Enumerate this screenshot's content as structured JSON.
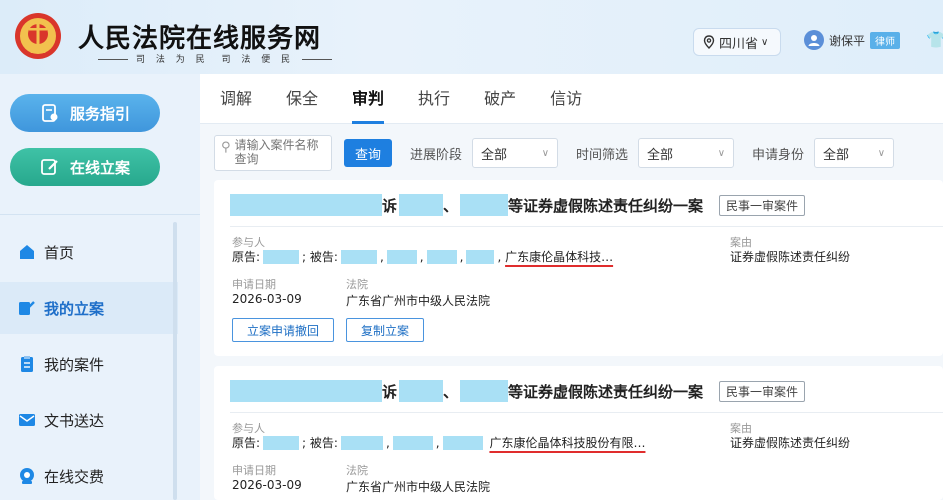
{
  "header": {
    "site_title": "人民法院在线服务网",
    "slogan_left": "司 法 为 民",
    "slogan_right": "司 法 便 民",
    "region": "四川省",
    "user_name": "谢保平",
    "user_badge": "律师"
  },
  "sidebar": {
    "guide_button": "服务指引",
    "file_button": "在线立案",
    "items": [
      {
        "label": "首页",
        "icon": "home-icon",
        "color": "#1e88e5"
      },
      {
        "label": "我的立案",
        "icon": "edit-icon",
        "color": "#1e88e5",
        "active": true
      },
      {
        "label": "我的案件",
        "icon": "clipboard-icon",
        "color": "#1e88e5"
      },
      {
        "label": "文书送达",
        "icon": "mail-icon",
        "color": "#1e88e5"
      },
      {
        "label": "在线交费",
        "icon": "payment-icon",
        "color": "#1e88e5"
      }
    ]
  },
  "tabs": [
    "调解",
    "保全",
    "审判",
    "执行",
    "破产",
    "信访"
  ],
  "active_tab": "审判",
  "filters": {
    "search_placeholder": "请输入案件名称查询",
    "query_button": "查询",
    "stage_label": "进展阶段",
    "stage_value": "全部",
    "time_label": "时间筛选",
    "time_value": "全部",
    "role_label": "申请身份",
    "role_value": "全部"
  },
  "cases": [
    {
      "title_part1": "诉",
      "title_sep": "、",
      "title_part2": "等证券虚假陈述责任纠纷一案",
      "case_type": "民事一审案件",
      "participants_label": "参与人",
      "plaintiff_label": "原告:",
      "defendant_label": "被告:",
      "defendant_visible": "广东康伦晶体科技…",
      "cause_label": "案由",
      "cause": "证券虚假陈述责任纠纷",
      "date_label": "申请日期",
      "date": "2026-03-09",
      "court_label": "法院",
      "court": "广东省广州市中级人民法院",
      "actions": [
        "立案申请撤回",
        "复制立案"
      ]
    },
    {
      "title_part1": "诉",
      "title_sep": "、",
      "title_part2": "等证券虚假陈述责任纠纷一案",
      "case_type": "民事一审案件",
      "participants_label": "参与人",
      "plaintiff_label": "原告:",
      "defendant_label": "被告:",
      "defendant_visible": "广东康伦晶体科技股份有限…",
      "cause_label": "案由",
      "cause": "证券虚假陈述责任纠纷",
      "date_label": "申请日期",
      "date": "2026-03-09",
      "court_label": "法院",
      "court": "广东省广州市中级人民法院"
    }
  ],
  "colors": {
    "accent": "#1e7fe0",
    "guide_button": "#4aa6e6",
    "file_button": "#2fb598",
    "redaction": "#a9e0f5",
    "annotation_underline": "#e02d2d"
  }
}
